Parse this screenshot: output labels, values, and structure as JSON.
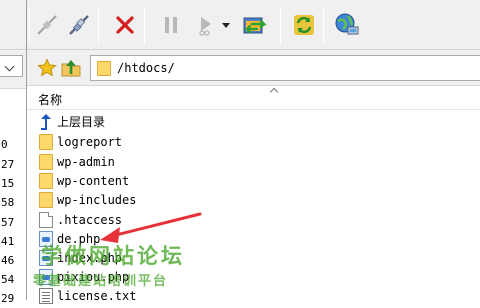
{
  "left_pane": {
    "row_numbers": [
      "0",
      "27",
      "15",
      "58",
      "57",
      "41",
      "46",
      "54",
      "29"
    ]
  },
  "toolbar": {
    "buttons": [
      {
        "icon": "plug-connect-icon",
        "state": "disabled"
      },
      {
        "icon": "plug-disconnect-icon",
        "state": "enabled"
      },
      {
        "icon": "stop-x-icon",
        "state": "enabled"
      },
      {
        "icon": "pause-icon",
        "state": "disabled"
      },
      {
        "icon": "play-script-icon",
        "state": "disabled"
      },
      {
        "icon": "dropdown-arrow-icon",
        "state": "enabled"
      },
      {
        "icon": "transfer-window-icon",
        "state": "enabled"
      },
      {
        "icon": "sync-refresh-icon",
        "state": "enabled"
      },
      {
        "icon": "globe-computer-icon",
        "state": "enabled"
      }
    ]
  },
  "address_bar": {
    "path": "/htdocs/"
  },
  "file_list": {
    "column_name": "名称",
    "items": [
      {
        "name": "上层目录",
        "type": "parent"
      },
      {
        "name": "logreport",
        "type": "folder"
      },
      {
        "name": "wp-admin",
        "type": "folder"
      },
      {
        "name": "wp-content",
        "type": "folder"
      },
      {
        "name": "wp-includes",
        "type": "folder"
      },
      {
        "name": ".htaccess",
        "type": "file"
      },
      {
        "name": "de.php",
        "type": "php"
      },
      {
        "name": "index.php",
        "type": "php"
      },
      {
        "name": "pixiou.php",
        "type": "php"
      },
      {
        "name": "license.txt",
        "type": "txt"
      }
    ]
  },
  "watermark": {
    "title": "学做网站论坛",
    "subtitle": "零基础建站培训平台",
    "color": "#46a528"
  },
  "annotation": {
    "arrow_color": "#e8333a"
  }
}
